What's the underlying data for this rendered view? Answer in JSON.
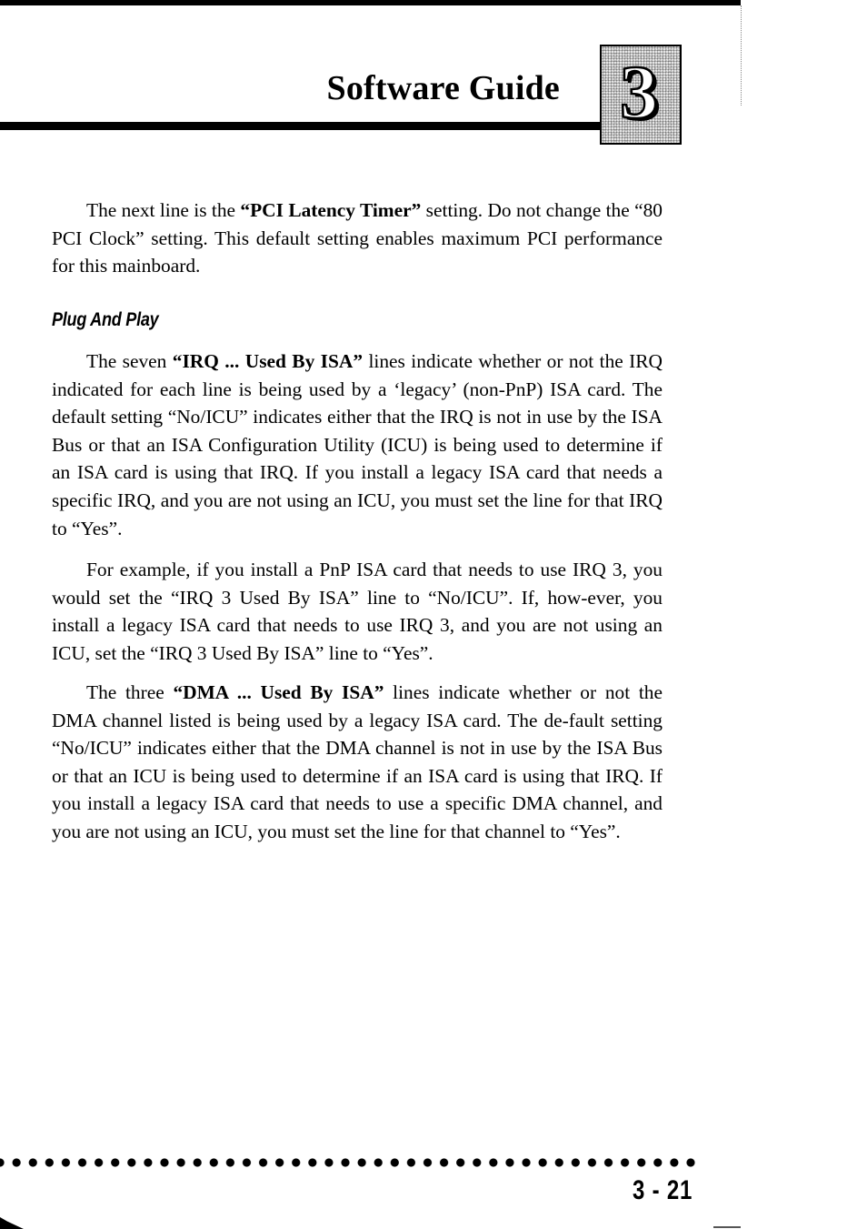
{
  "header": {
    "title": "Software Guide",
    "chapter_number": "3"
  },
  "body": {
    "paragraph_1": {
      "t1": "The next line is the ",
      "b1": "“PCI Latency Timer”",
      "t2": " setting. Do not change the “80 PCI Clock” setting. This default setting enables maximum PCI performance for this mainboard."
    },
    "section_heading": "Plug And Play",
    "paragraph_2": {
      "t1": "The seven ",
      "b1": "“IRQ ... Used By ISA”",
      "t2": " lines indicate whether or not the IRQ indicated for each line is being used by a ‘legacy’ (non-PnP) ISA card. The default setting “No/ICU” indicates either that the IRQ is not in use by the ISA Bus or that an ISA Configuration Utility (ICU) is being used to determine if an ISA card is using that IRQ. If you install a legacy ISA card that needs a specific IRQ, and you are not using an ICU, you must set the line for that IRQ to “Yes”."
    },
    "paragraph_3": "For example, if you install a PnP ISA card that needs to use IRQ 3, you would set the “IRQ 3 Used By ISA” line to “No/ICU”. If, how-ever, you install a legacy ISA card that needs to use IRQ 3, and you are not using an ICU, set the “IRQ 3 Used By ISA” line to “Yes”.",
    "paragraph_4": {
      "t1": "The three ",
      "b1": "“DMA ... Used By ISA”",
      "t2": " lines indicate whether or not the DMA channel listed is being used by a legacy ISA card. The de-fault setting “No/ICU” indicates either that the DMA channel is not in use by the ISA Bus or that an ICU is being used to determine if an ISA card is using that IRQ. If you install a legacy ISA card that needs to use a specific DMA channel, and you are not using an ICU, you must set the line for that channel to “Yes”."
    }
  },
  "footer": {
    "page_number": "3 - 21"
  }
}
